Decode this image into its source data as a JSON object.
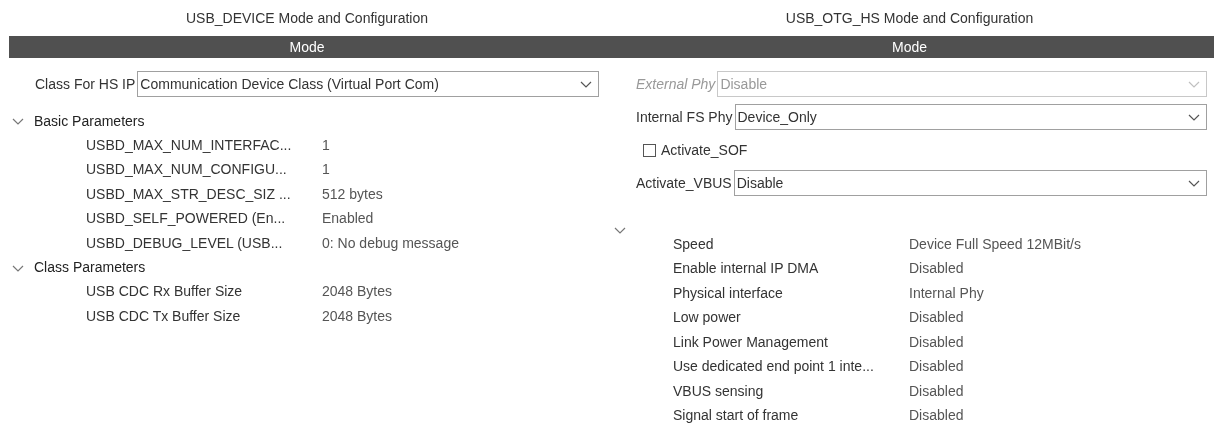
{
  "panels": [
    {
      "title": "USB_DEVICE Mode and Configuration",
      "mode_header": "Mode",
      "fields": [
        {
          "kind": "select",
          "label": "Class For HS IP",
          "value": "Communication Device Class (Virtual Port Com)",
          "disabled": false
        }
      ],
      "groups": [
        {
          "label": "Basic Parameters",
          "expanded": true,
          "children": [
            {
              "name": "USBD_MAX_NUM_INTERFAC...",
              "value": "1"
            },
            {
              "name": "USBD_MAX_NUM_CONFIGU...",
              "value": "1"
            },
            {
              "name": "USBD_MAX_STR_DESC_SIZ ...",
              "value": "512 bytes"
            },
            {
              "name": "USBD_SELF_POWERED (En...",
              "value": "Enabled"
            },
            {
              "name": "USBD_DEBUG_LEVEL (USB...",
              "value": "0: No debug message"
            }
          ]
        },
        {
          "label": "Class Parameters",
          "expanded": true,
          "children": [
            {
              "name": "USB CDC Rx Buffer Size",
              "value": "2048 Bytes"
            },
            {
              "name": "USB CDC Tx Buffer Size",
              "value": "2048 Bytes"
            }
          ]
        }
      ]
    },
    {
      "title": "USB_OTG_HS Mode and Configuration",
      "mode_header": "Mode",
      "fields": [
        {
          "kind": "select",
          "label": "External Phy",
          "value": "Disable",
          "disabled": true
        },
        {
          "kind": "select",
          "label": "Internal FS Phy",
          "value": "Device_Only",
          "disabled": false
        },
        {
          "kind": "checkbox",
          "label": "Activate_SOF",
          "checked": false
        },
        {
          "kind": "select",
          "label": "Activate_VBUS",
          "value": "Disable",
          "disabled": false
        }
      ],
      "groups": [
        {
          "expanded": true,
          "children": [
            {
              "name": "Speed",
              "value": "Device Full Speed 12MBit/s"
            },
            {
              "name": "Enable internal IP DMA",
              "value": "Disabled"
            },
            {
              "name": "Physical interface",
              "value": "Internal Phy"
            },
            {
              "name": "Low power",
              "value": "Disabled"
            },
            {
              "name": "Link Power Management",
              "value": "Disabled"
            },
            {
              "name": "Use dedicated end point 1 inte...",
              "value": "Disabled"
            },
            {
              "name": "VBUS sensing",
              "value": "Disabled"
            },
            {
              "name": "Signal start of frame",
              "value": "Disabled"
            }
          ]
        }
      ]
    }
  ]
}
